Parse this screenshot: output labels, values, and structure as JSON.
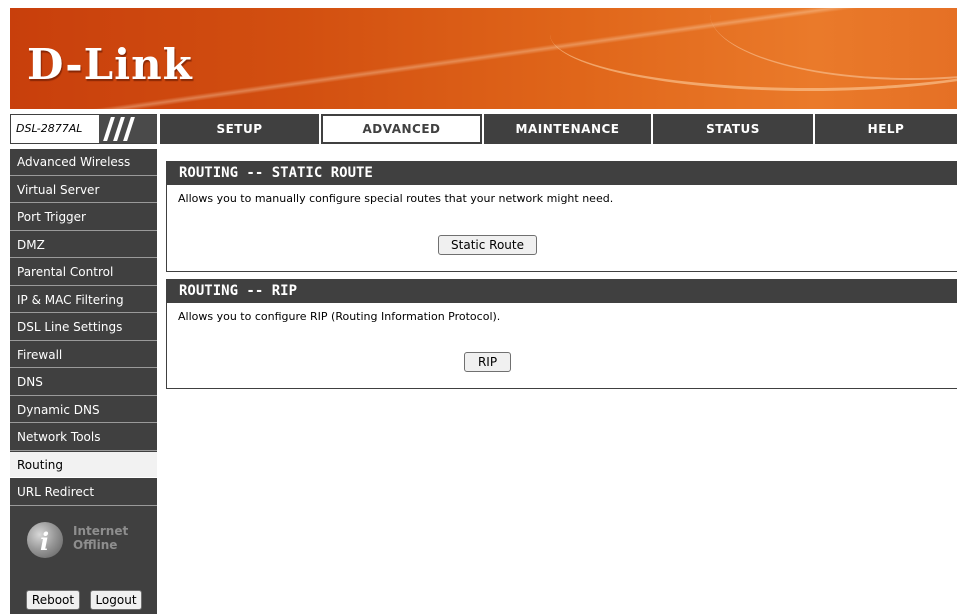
{
  "brand": {
    "logo_text": "D-Link",
    "model": "DSL-2877AL"
  },
  "nav": {
    "tabs": [
      {
        "label": "SETUP",
        "active": false
      },
      {
        "label": "ADVANCED",
        "active": true
      },
      {
        "label": "MAINTENANCE",
        "active": false
      },
      {
        "label": "STATUS",
        "active": false
      },
      {
        "label": "HELP",
        "active": false
      }
    ]
  },
  "sidebar": {
    "items": [
      {
        "label": "Advanced Wireless"
      },
      {
        "label": "Virtual Server"
      },
      {
        "label": "Port Trigger"
      },
      {
        "label": "DMZ"
      },
      {
        "label": "Parental Control"
      },
      {
        "label": "IP & MAC Filtering"
      },
      {
        "label": "DSL Line Settings"
      },
      {
        "label": "Firewall"
      },
      {
        "label": "DNS"
      },
      {
        "label": "Dynamic DNS"
      },
      {
        "label": "Network Tools"
      },
      {
        "label": "Routing",
        "active": true
      },
      {
        "label": "URL Redirect"
      }
    ],
    "internet_status": {
      "line1": "Internet",
      "line2": "Offline"
    },
    "reboot_label": "Reboot",
    "logout_label": "Logout"
  },
  "sections": {
    "static_route": {
      "title": "ROUTING -- STATIC ROUTE",
      "description": "Allows you to manually configure special routes that your network might need.",
      "button_label": "Static Route"
    },
    "rip": {
      "title": "ROUTING -- RIP",
      "description": "Allows you to configure RIP (Routing Information Protocol).",
      "button_label": "RIP"
    }
  },
  "colors": {
    "banner_orange": "#d24f10",
    "nav_dark": "#404040",
    "active_bg": "#f2f2f2"
  }
}
